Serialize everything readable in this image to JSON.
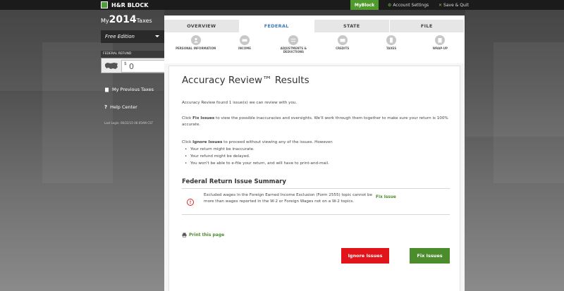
{
  "header": {
    "logo_text": "H&R BLOCK",
    "myblock_label": "MyBlock",
    "account_settings_label": "Account Settings",
    "save_quit_label": "Save & Quit"
  },
  "sidebar": {
    "brand_my": "My",
    "brand_year": "2014",
    "brand_taxes": "Taxes",
    "edition": "Free Edition",
    "refund_label": "FEDERAL REFUND",
    "refund_currency": "$",
    "refund_amount": "0",
    "previous_taxes_label": "My Previous Taxes",
    "help_center_label": "Help Center",
    "last_login": "Last Login: 06/22/15 06:05AM CST"
  },
  "tabs": [
    "OVERVIEW",
    "FEDERAL",
    "STATE",
    "FILE"
  ],
  "steps": [
    "PERSONAL INFORMATION",
    "INCOME",
    "ADJUSTMENTS & DEDUCTIONS",
    "CREDITS",
    "TAXES",
    "WRAP-UP"
  ],
  "main": {
    "title": "Accuracy Review™ Results",
    "found_text": "Accuracy Review found 1 issue(s) we can review with you.",
    "fix_click": "Click ",
    "fix_bold": "Fix Issues",
    "fix_rest": " to view the possible inaccuracies and oversights. We'll work through them together to make sure your return is 100% accurate.",
    "ignore_click": "Click ",
    "ignore_bold": "Ignore Issues",
    "ignore_rest": " to proceed without viewing any of the issues. However:",
    "bullets": [
      "Your return might be inaccurate.",
      "Your refund might be delayed.",
      "You won't be able to e-file your return, and will have to print-and-mail."
    ],
    "summary_title": "Federal Return Issue Summary",
    "issue_text": "Excluded wages in the Foreign Earned Income Exclusion (Form 2555) topic cannot be more than wages reported in the W-2 or Foreign Wages not on a W-2 topics.",
    "issue_link": "Fix Issue",
    "print_label": "Print this page",
    "ignore_button": "Ignore Issues",
    "fix_button": "Fix Issues"
  },
  "colors": {
    "brand_green": "#4f9a2c",
    "active_tab": "#3a7bbf",
    "ignore_red": "#e1141b",
    "link_green": "#4b8d2c"
  }
}
